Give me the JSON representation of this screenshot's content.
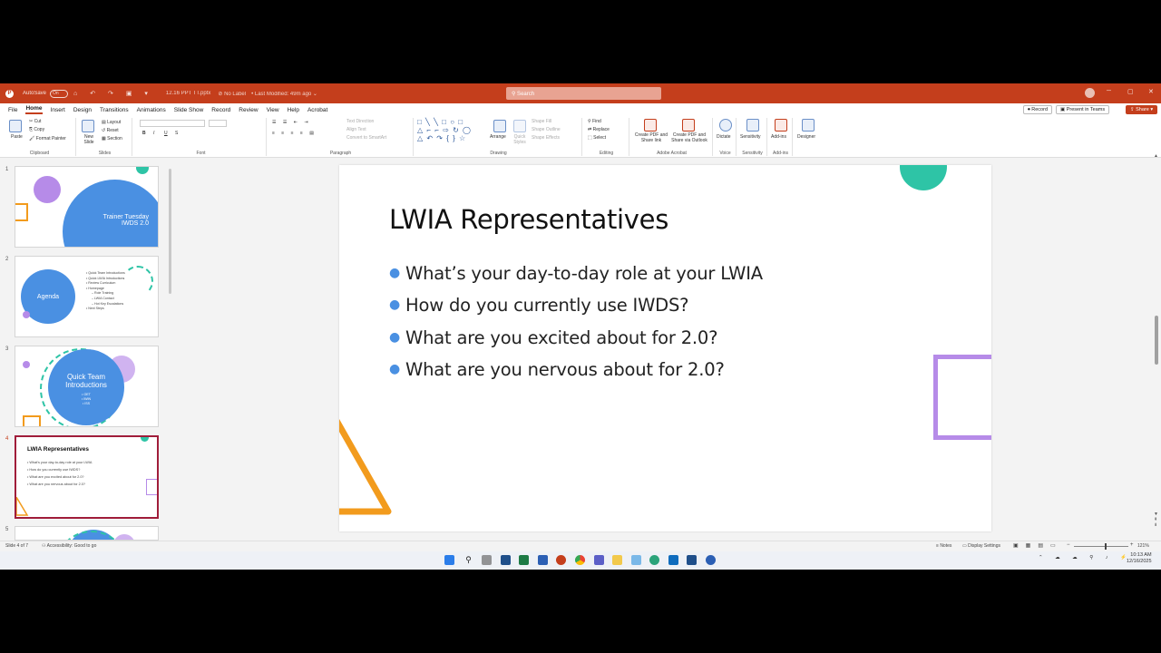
{
  "titlebar": {
    "app_logo": "P",
    "autosave_label": "AutoSave",
    "autosave_state": "On",
    "quick_access": "⌂ ↶ ↷ ▣ ▾",
    "doc_title": "12.16 PPT TT.pptx",
    "label_info": "⊘ No Label",
    "modified": "• Last Modified: 49m ago ⌄",
    "search_placeholder": "⚲  Search",
    "minimize": "─",
    "maximize": "▢",
    "close": "✕"
  },
  "tabs": [
    "File",
    "Home",
    "Insert",
    "Design",
    "Transitions",
    "Animations",
    "Slide Show",
    "Record",
    "Review",
    "View",
    "Help",
    "Acrobat"
  ],
  "tab_actions": {
    "record": "⏺ Record",
    "present": "▣ Present in Teams",
    "share": "⇪ Share ▾"
  },
  "ribbon": {
    "clipboard": {
      "paste": "Paste",
      "cut": "Cut",
      "copy": "Copy",
      "format_painter": "Format Painter",
      "label": "Clipboard"
    },
    "slides": {
      "new_slide": "New Slide",
      "layout": "Layout",
      "reset": "Reset",
      "section": "Section",
      "label": "Slides"
    },
    "font": {
      "bold": "B",
      "italic": "I",
      "underline": "U",
      "strike": "S",
      "label": "Font"
    },
    "paragraph": {
      "text_direction": "Text Direction",
      "align_text": "Align Text",
      "smartart": "Convert to SmartArt",
      "label": "Paragraph"
    },
    "drawing": {
      "arrange": "Arrange",
      "quick_styles": "Quick Styles",
      "shape_fill": "Shape Fill",
      "shape_outline": "Shape Outline",
      "shape_effects": "Shape Effects",
      "label": "Drawing"
    },
    "editing": {
      "find": "Find",
      "replace": "Replace",
      "select": "Select",
      "label": "Editing"
    },
    "acrobat": {
      "create_pdf_link": "Create PDF and Share link",
      "create_pdf_outlook": "Create PDF and Share via Outlook",
      "label": "Adobe Acrobat"
    },
    "voice": {
      "dictate": "Dictate",
      "label": "Voice"
    },
    "sensitivity": {
      "sensitivity": "Sensitivity",
      "label": "Sensitivity"
    },
    "addins": {
      "addins": "Add-ins",
      "label": "Add-ins"
    },
    "designer": {
      "designer": "Designer"
    }
  },
  "thumbnails": [
    {
      "num": "1",
      "title": "Trainer Tuesday\nIWDS 2.0",
      "line1": "Trainer Tuesday",
      "line2": "IWDS 2.0"
    },
    {
      "num": "2",
      "title": "Agenda",
      "items": [
        "Quick Team Introductions",
        "Quick LWIA Introductions",
        "Review Curriculum",
        "Homepage",
        "Role Training",
        "LWIA Contact",
        "Hot Key Escalations",
        "Next Steps"
      ]
    },
    {
      "num": "3",
      "line1": "Quick Team",
      "line2": "Introductions",
      "items": [
        "OET",
        "IWIN",
        "ISS"
      ]
    },
    {
      "num": "4",
      "title": "LWIA Representatives",
      "items": [
        "What's your day-to-day role at your LWIA",
        "How do you currently use IWDS?",
        "What are you excited about for 2.0?",
        "What are you nervous about for 2.0?"
      ]
    },
    {
      "num": "5"
    }
  ],
  "slide": {
    "title": "LWIA Representatives",
    "bullets": [
      "What’s your day-to-day role at your LWIA",
      "How do you currently use IWDS?",
      "What are you excited about for 2.0?",
      "What are you nervous about for 2.0?"
    ]
  },
  "status": {
    "slide_count": "Slide 4 of 7",
    "accessibility": "Accessibility: Good to go",
    "notes": "Notes",
    "display_settings": "Display Settings",
    "zoom": "121%"
  },
  "taskbar": {
    "time": "10:13 AM",
    "date": "12/16/2025"
  },
  "colors": {
    "accent": "#c43e1c",
    "blue": "#4a90e2",
    "teal": "#2ec4a6",
    "purple": "#b68be8",
    "orange": "#f29b1d"
  }
}
